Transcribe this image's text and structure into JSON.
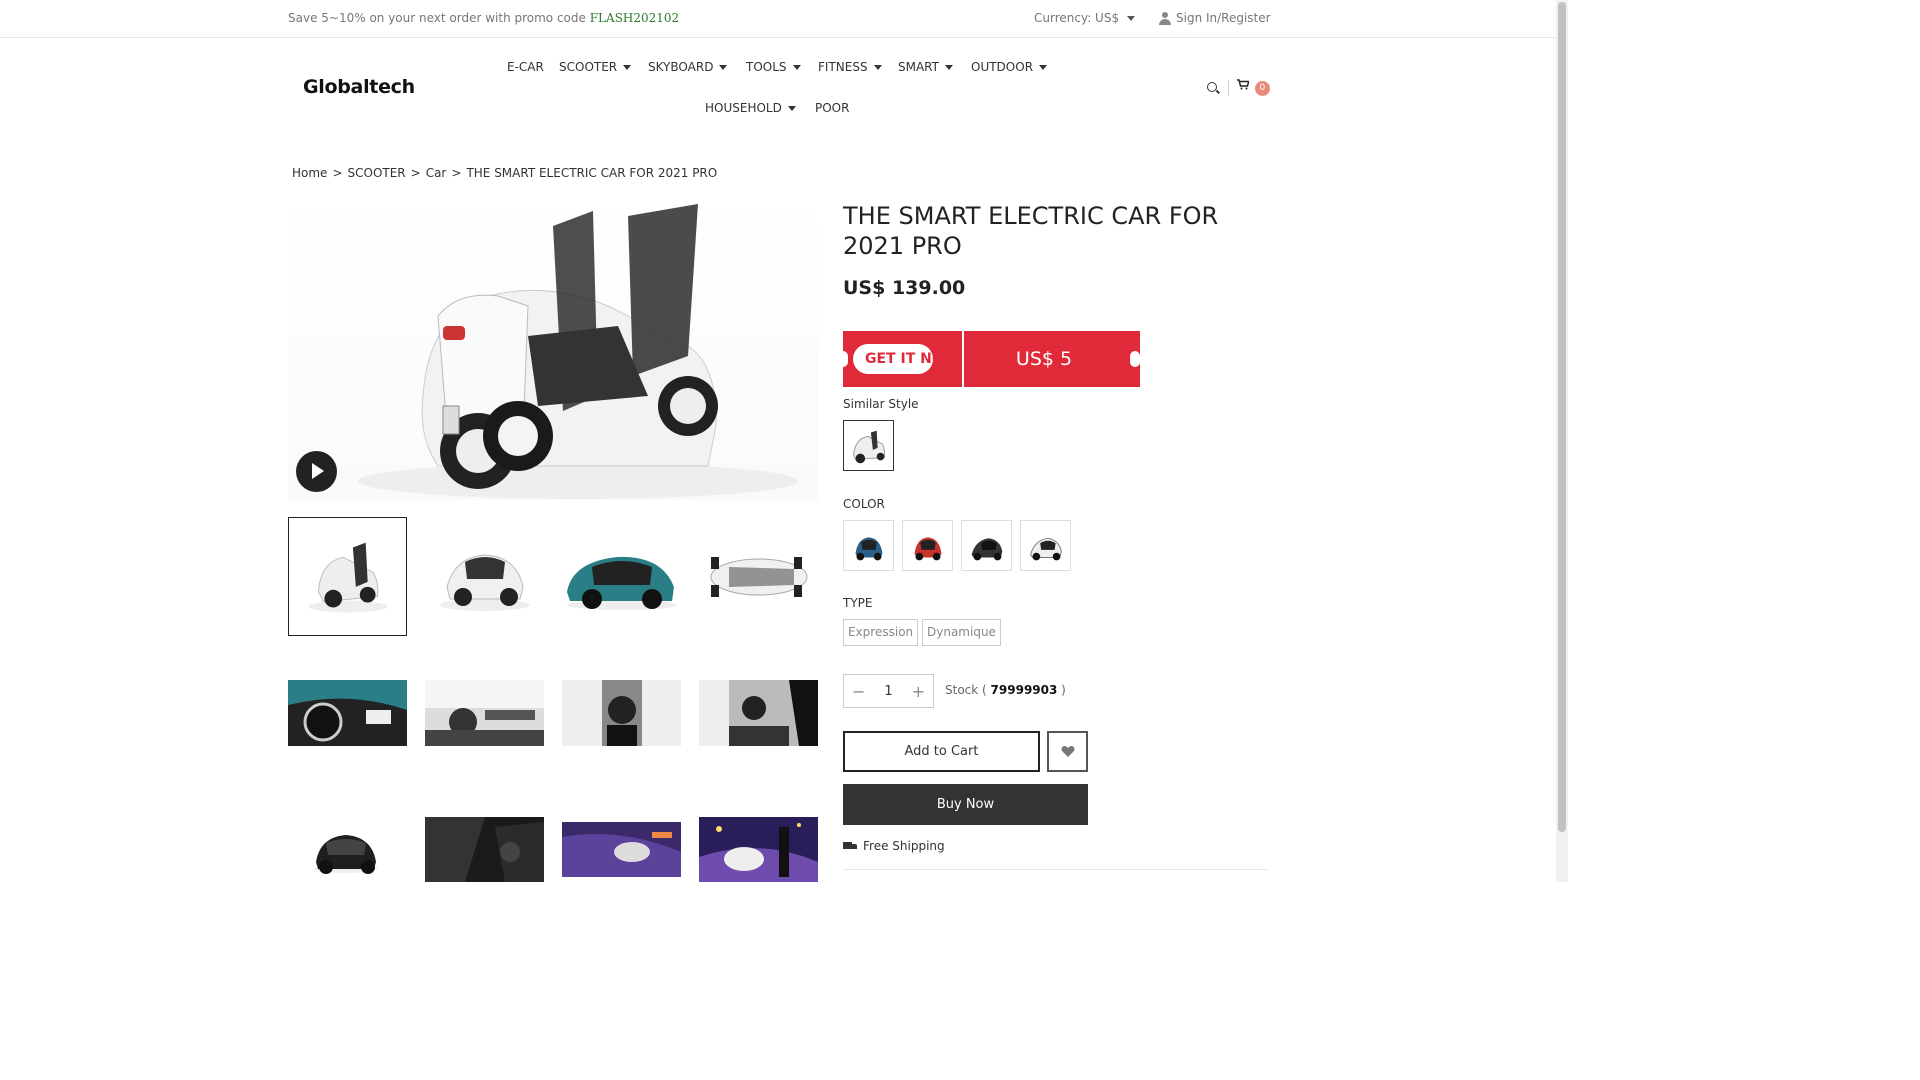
{
  "topbar": {
    "promo_text": "Save 5~10% on your next order with promo code",
    "promo_code": "FLASH202102",
    "currency_label": "Currency: US$",
    "signin_label": "Sign In/Register"
  },
  "header": {
    "logo": "Globaltech",
    "nav": [
      "E-CAR",
      "SCOOTER",
      "SKYBOARD",
      "TOOLS",
      "FITNESS",
      "SMART",
      "OUTDOOR",
      "HOUSEHOLD",
      "POOR"
    ],
    "cart_count": "0"
  },
  "breadcrumb": [
    "Home",
    ">",
    "SCOOTER",
    ">",
    "Car",
    ">",
    "THE SMART ELECTRIC CAR FOR 2021 PRO"
  ],
  "product": {
    "title": "THE SMART ELECTRIC CAR FOR 2021 PRO",
    "price": "US$ 139.00",
    "coupon_button": "GET IT NOW",
    "coupon_value": "US$ 5",
    "similar_style_label": "Similar Style",
    "color_label": "COLOR",
    "type_label": "TYPE",
    "type_options": [
      "Expression",
      "Dynamique"
    ],
    "quantity": "1",
    "stock_prefix": "Stock (",
    "stock_value": "79999903",
    "stock_suffix": ")",
    "add_to_cart": "Add to Cart",
    "buy_now": "Buy Now",
    "shipping": "Free Shipping"
  },
  "colors": {
    "coupon_red": "#e02a3a",
    "buy_now_bg": "#333333",
    "promo_code": "#2a7a2a",
    "cart_badge": "#e98b7a"
  }
}
